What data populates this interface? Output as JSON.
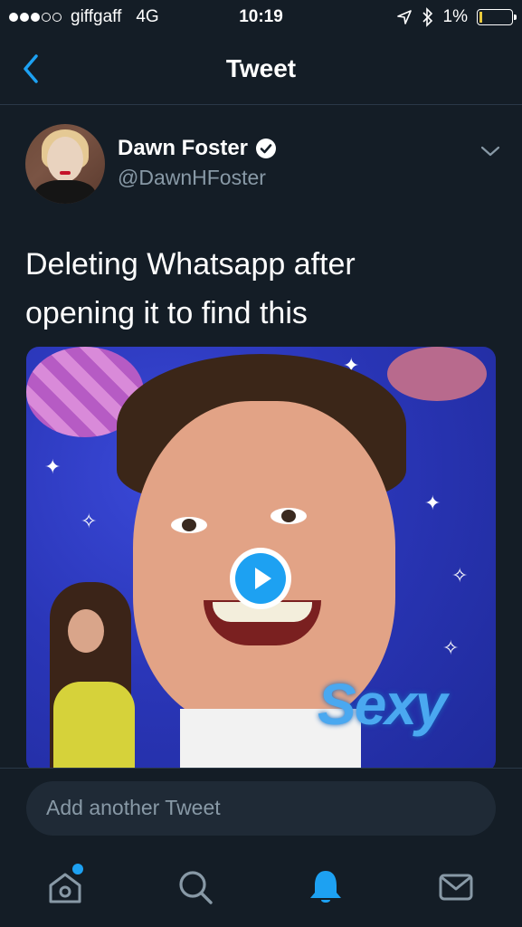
{
  "status_bar": {
    "carrier": "giffgaff",
    "network": "4G",
    "time": "10:19",
    "battery": "1%",
    "battery_level": 0.01
  },
  "nav": {
    "title": "Tweet",
    "back_icon": "chevron-left-icon"
  },
  "tweet": {
    "author_name": "Dawn Foster",
    "author_handle": "@DawnHFoster",
    "verified_icon": "verified-badge-icon",
    "text_line1": "Deleting Whatsapp after",
    "text_line2": "opening it to find this",
    "media_overlay_text": "Sexy",
    "play_icon": "play-icon"
  },
  "composer": {
    "placeholder": "Add another Tweet"
  },
  "tab_bar": {
    "items": [
      {
        "icon": "home-icon",
        "has_badge": true
      },
      {
        "icon": "search-icon",
        "has_badge": false
      },
      {
        "icon": "bell-icon",
        "active": true
      },
      {
        "icon": "mail-icon",
        "has_badge": false
      }
    ]
  },
  "colors": {
    "background": "#141d26",
    "accent": "#1da1f2",
    "secondary_text": "#8899a6"
  }
}
